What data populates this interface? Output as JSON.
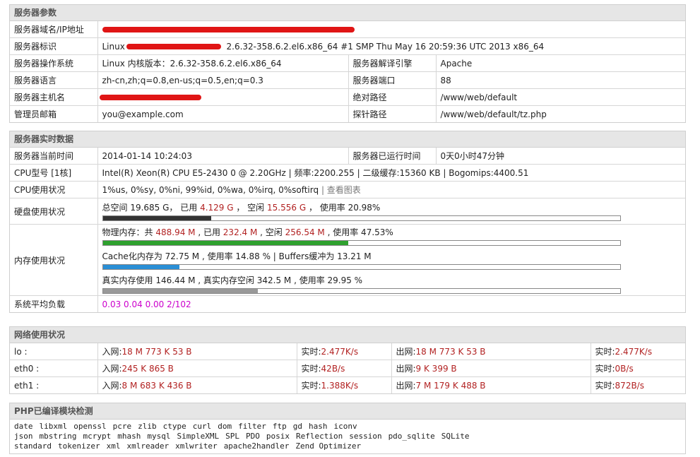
{
  "server_params": {
    "title": "服务器参数",
    "rows": {
      "domain_label": "服务器域名/IP地址",
      "domain_value": "",
      "ident_label": "服务器标识",
      "ident_value": "Linux",
      "ident_value_suffix": "2.6.32-358.6.2.el6.x86_64 #1 SMP Thu May 16 20:59:36 UTC 2013 x86_64",
      "os_label": "服务器操作系统",
      "os_value": "Linux  内核版本：2.6.32-358.6.2.el6.x86_64",
      "engine_label": "服务器解译引擎",
      "engine_value": "Apache",
      "lang_label": "服务器语言",
      "lang_value": "zh-cn,zh;q=0.8,en-us;q=0.5,en;q=0.3",
      "port_label": "服务器端口",
      "port_value": "88",
      "host_label": "服务器主机名",
      "host_value": "",
      "abspath_label": "绝对路径",
      "abspath_value": "/www/web/default",
      "admin_label": "管理员邮箱",
      "admin_value": "you@example.com",
      "probe_label": "探针路径",
      "probe_value": "/www/web/default/tz.php"
    }
  },
  "realtime": {
    "title": "服务器实时数据",
    "time_label": "服务器当前时间",
    "time_value": "2014-01-14 10:24:03",
    "uptime_label": "服务器已运行时间",
    "uptime_value": "0天0小时47分钟",
    "cpu_label": "CPU型号 [1核]",
    "cpu_value": "Intel(R) Xeon(R) CPU E5-2430 0 @ 2.20GHz | 频率:2200.255 | 二级缓存:15360 KB | Bogomips:4400.51",
    "cpu_usage_label": "CPU使用状况",
    "cpu_usage_value": "1%us, 0%sy, 0%ni, 99%id, 0%wa, 0%irq, 0%softirq",
    "cpu_usage_link": "| 查看图表",
    "disk_label": "硬盘使用状况",
    "disk_prefix": "总空间 19.685 G，  已用",
    "disk_used": "4.129 G",
    "disk_mid": "，  空闲",
    "disk_free": "15.556 G",
    "disk_suffix": "，  使用率 20.98%",
    "disk_percent": 20.98,
    "mem_label": "内存使用状况",
    "mem_phys_prefix": "物理内存：共",
    "mem_phys_total": "488.94 M",
    "mem_phys_used_label": ", 已用",
    "mem_phys_used": "232.4 M",
    "mem_phys_free_label": ", 空闲",
    "mem_phys_free": "256.54 M",
    "mem_phys_suffix": ", 使用率 47.53%",
    "mem_phys_percent": 47.53,
    "mem_cache_text": "Cache化内存为 72.75 M , 使用率 14.88 % | Buffers缓冲为 13.21 M",
    "mem_cache_percent": 14.88,
    "mem_real_text": "真实内存使用 146.44 M , 真实内存空闲 342.5 M , 使用率 29.95 %",
    "mem_real_percent": 29.95,
    "load_label": "系统平均负载",
    "load_value": "0.03 0.04 0.00 2/102",
    "colors": {
      "disk": "#333333",
      "phys": "#2ea12e",
      "cache": "#2a8fd6",
      "real": "#999999"
    }
  },
  "network": {
    "title": "网络使用状况",
    "rows": [
      {
        "name": "lo :",
        "in_label": "入网:",
        "in": "18 M 773 K 53 B",
        "rt_label": "实时:",
        "rt_in": "2.477K/s",
        "out_label": "出网:",
        "out": "18 M 773 K 53 B",
        "rt_out": "2.477K/s"
      },
      {
        "name": "eth0 :",
        "in_label": "入网:",
        "in": "245 K 865 B",
        "rt_label": "实时:",
        "rt_in": "42B/s",
        "out_label": "出网:",
        "out": "9 K 399 B",
        "rt_out": "0B/s"
      },
      {
        "name": "eth1 :",
        "in_label": "入网:",
        "in": "8 M 683 K 436 B",
        "rt_label": "实时:",
        "rt_in": "1.388K/s",
        "out_label": "出网:",
        "out": "7 M 179 K 488 B",
        "rt_out": "872B/s"
      }
    ]
  },
  "php_modules": {
    "title": "PHP已编译模块检测",
    "lines": [
      [
        "date",
        "libxml",
        "openssl",
        "pcre",
        "zlib",
        "ctype",
        "curl",
        "dom",
        "filter",
        "ftp",
        "gd",
        "hash",
        "iconv"
      ],
      [
        "json",
        "mbstring",
        "mcrypt",
        "mhash",
        "mysql",
        "SimpleXML",
        "SPL",
        "PDO",
        "posix",
        "Reflection",
        "session",
        "pdo_sqlite",
        "SQLite"
      ],
      [
        "standard",
        "tokenizer",
        "xml",
        "xmlreader",
        "xmlwriter",
        "apache2handler",
        "Zend Optimizer"
      ]
    ]
  }
}
